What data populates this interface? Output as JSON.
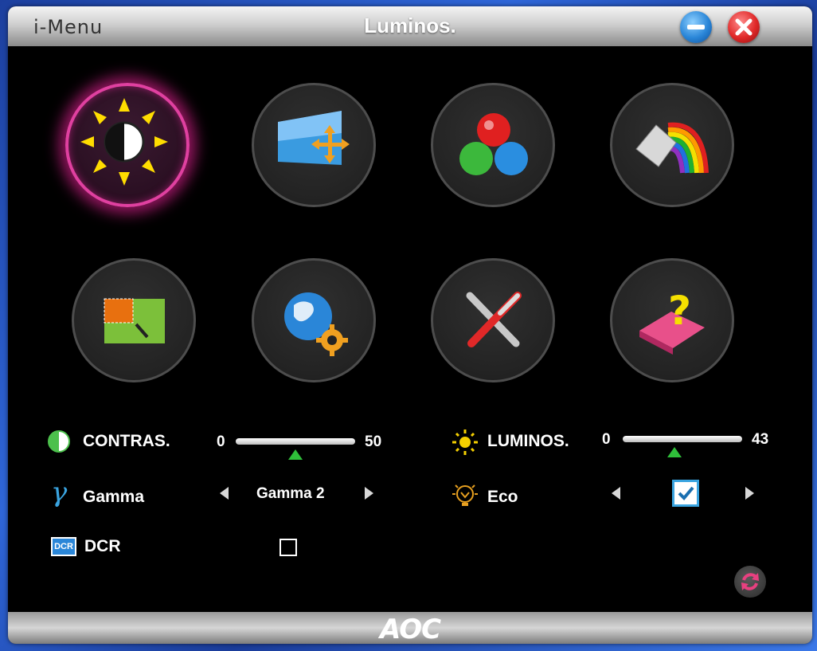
{
  "window": {
    "app_name": "i-Menu",
    "title": "Luminos."
  },
  "titlebar_buttons": [
    {
      "name": "minimize-button",
      "icon": "minus-icon",
      "color": "#2a86d8"
    },
    {
      "name": "close-button",
      "icon": "x-icon",
      "color": "#e02828"
    }
  ],
  "tiles": [
    {
      "name": "luminance-tile",
      "icon": "sun-contrast-icon",
      "active": true
    },
    {
      "name": "image-setup-tile",
      "icon": "image-move-icon",
      "active": false
    },
    {
      "name": "color-temp-tile",
      "icon": "rgb-balls-icon",
      "active": false
    },
    {
      "name": "color-boost-tile",
      "icon": "paint-rainbow-icon",
      "active": false
    },
    {
      "name": "picture-boost-tile",
      "icon": "picture-area-icon",
      "active": false
    },
    {
      "name": "osd-setup-tile",
      "icon": "globe-gear-icon",
      "active": false
    },
    {
      "name": "extra-tile",
      "icon": "tools-icon",
      "active": false
    },
    {
      "name": "help-tile",
      "icon": "book-question-icon",
      "active": false
    }
  ],
  "controls": {
    "contrast": {
      "label": "CONTRAS.",
      "min": "0",
      "max": "50",
      "value": 0.5
    },
    "luminance": {
      "label": "LUMINOS.",
      "min": "0",
      "max": "43",
      "value": 0.43
    },
    "gamma": {
      "label": "Gamma",
      "value": "Gamma 2"
    },
    "eco": {
      "label": "Eco",
      "checked": true
    },
    "dcr": {
      "label": "DCR",
      "icon_text": "DCR",
      "checked": false
    }
  },
  "footer": {
    "brand": "AOC",
    "reset_icon": "reset-icon"
  },
  "colors": {
    "active_glow": "#e040a0",
    "slider_thumb": "#2fbf3a",
    "check_border": "#3aa4e0"
  }
}
